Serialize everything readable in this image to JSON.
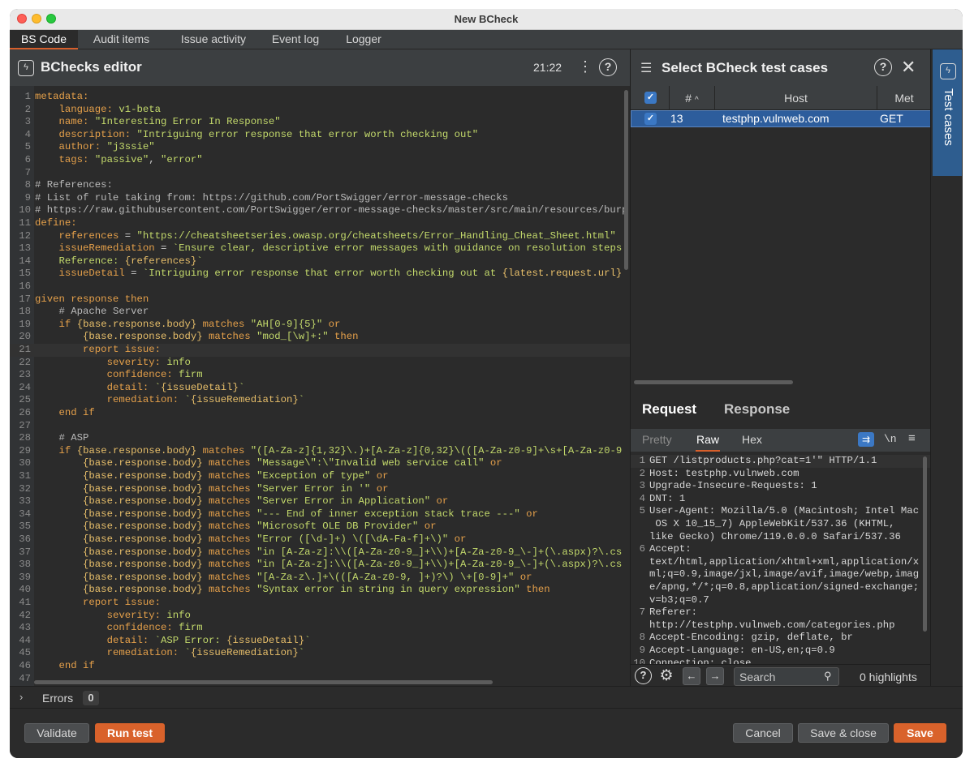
{
  "window": {
    "title": "New BCheck"
  },
  "tabs": [
    "BS Code",
    "Audit items",
    "Issue activity",
    "Event log",
    "Logger"
  ],
  "editor": {
    "title": "BChecks editor",
    "cursor_position": "21:22",
    "code_lines": [
      [
        [
          "k",
          "metadata:"
        ]
      ],
      [
        [
          "t",
          "    "
        ],
        [
          "k",
          "language:"
        ],
        [
          "t",
          " "
        ],
        [
          "s",
          "v1-beta"
        ]
      ],
      [
        [
          "t",
          "    "
        ],
        [
          "k",
          "name:"
        ],
        [
          "t",
          " "
        ],
        [
          "s",
          "\"Interesting Error In Response\""
        ]
      ],
      [
        [
          "t",
          "    "
        ],
        [
          "k",
          "description:"
        ],
        [
          "t",
          " "
        ],
        [
          "s",
          "\"Intriguing error response that error worth checking out\""
        ]
      ],
      [
        [
          "t",
          "    "
        ],
        [
          "k",
          "author:"
        ],
        [
          "t",
          " "
        ],
        [
          "s",
          "\"j3ssie\""
        ]
      ],
      [
        [
          "t",
          "    "
        ],
        [
          "k",
          "tags:"
        ],
        [
          "t",
          " "
        ],
        [
          "s",
          "\"passive\""
        ],
        [
          "t",
          ", "
        ],
        [
          "s",
          "\"error\""
        ]
      ],
      [],
      [
        [
          "c",
          "# References:"
        ]
      ],
      [
        [
          "c",
          "# List of rule taking from: https://github.com/PortSwigger/error-message-checks"
        ]
      ],
      [
        [
          "c",
          "# https://raw.githubusercontent.com/PortSwigger/error-message-checks/master/src/main/resources/burp"
        ]
      ],
      [
        [
          "k",
          "define:"
        ]
      ],
      [
        [
          "t",
          "    "
        ],
        [
          "k",
          "references"
        ],
        [
          "t",
          " = "
        ],
        [
          "s",
          "\"https://cheatsheetseries.owasp.org/cheatsheets/Error_Handling_Cheat_Sheet.html\""
        ]
      ],
      [
        [
          "t",
          "    "
        ],
        [
          "k",
          "issueRemediation"
        ],
        [
          "t",
          " = "
        ],
        [
          "s",
          "`Ensure clear, descriptive error messages with guidance on resolution steps"
        ]
      ],
      [
        [
          "t",
          "    "
        ],
        [
          "s",
          "Reference: "
        ],
        [
          "v",
          "{references}"
        ],
        [
          "s",
          "`"
        ]
      ],
      [
        [
          "t",
          "    "
        ],
        [
          "k",
          "issueDetail"
        ],
        [
          "t",
          " = "
        ],
        [
          "s",
          "`Intriguing error response that error worth checking out at "
        ],
        [
          "v",
          "{latest.request.url}"
        ]
      ],
      [],
      [
        [
          "k",
          "given response then"
        ]
      ],
      [
        [
          "t",
          "    "
        ],
        [
          "c",
          "# Apache Server"
        ]
      ],
      [
        [
          "t",
          "    "
        ],
        [
          "k",
          "if"
        ],
        [
          "t",
          " "
        ],
        [
          "v",
          "{base.response.body}"
        ],
        [
          "t",
          " "
        ],
        [
          "k",
          "matches"
        ],
        [
          "t",
          " "
        ],
        [
          "s",
          "\"AH[0-9]{5}\""
        ],
        [
          "t",
          " "
        ],
        [
          "k",
          "or"
        ]
      ],
      [
        [
          "t",
          "        "
        ],
        [
          "v",
          "{base.response.body}"
        ],
        [
          "t",
          " "
        ],
        [
          "k",
          "matches"
        ],
        [
          "t",
          " "
        ],
        [
          "s",
          "\"mod_[\\w]+:\""
        ],
        [
          "t",
          " "
        ],
        [
          "k",
          "then"
        ]
      ],
      [
        [
          "t",
          "        "
        ],
        [
          "k",
          "report issue:"
        ]
      ],
      [
        [
          "t",
          "            "
        ],
        [
          "k",
          "severity:"
        ],
        [
          "t",
          " "
        ],
        [
          "s",
          "info"
        ]
      ],
      [
        [
          "t",
          "            "
        ],
        [
          "k",
          "confidence:"
        ],
        [
          "t",
          " "
        ],
        [
          "s",
          "firm"
        ]
      ],
      [
        [
          "t",
          "            "
        ],
        [
          "k",
          "detail:"
        ],
        [
          "t",
          " "
        ],
        [
          "s",
          "`"
        ],
        [
          "v",
          "{issueDetail}"
        ],
        [
          "s",
          "`"
        ]
      ],
      [
        [
          "t",
          "            "
        ],
        [
          "k",
          "remediation:"
        ],
        [
          "t",
          " "
        ],
        [
          "s",
          "`"
        ],
        [
          "v",
          "{issueRemediation}"
        ],
        [
          "s",
          "`"
        ]
      ],
      [
        [
          "t",
          "    "
        ],
        [
          "k",
          "end if"
        ]
      ],
      [],
      [
        [
          "t",
          "    "
        ],
        [
          "c",
          "# ASP"
        ]
      ],
      [
        [
          "t",
          "    "
        ],
        [
          "k",
          "if"
        ],
        [
          "t",
          " "
        ],
        [
          "v",
          "{base.response.body}"
        ],
        [
          "t",
          " "
        ],
        [
          "k",
          "matches"
        ],
        [
          "t",
          " "
        ],
        [
          "s",
          "\"([A-Za-z]{1,32}\\.)+[A-Za-z]{0,32}\\(([A-Za-z0-9]+\\s+[A-Za-z0-9"
        ]
      ],
      [
        [
          "t",
          "        "
        ],
        [
          "v",
          "{base.response.body}"
        ],
        [
          "t",
          " "
        ],
        [
          "k",
          "matches"
        ],
        [
          "t",
          " "
        ],
        [
          "s",
          "\"Message\\\":\\\"Invalid web service call\""
        ],
        [
          "t",
          " "
        ],
        [
          "k",
          "or"
        ]
      ],
      [
        [
          "t",
          "        "
        ],
        [
          "v",
          "{base.response.body}"
        ],
        [
          "t",
          " "
        ],
        [
          "k",
          "matches"
        ],
        [
          "t",
          " "
        ],
        [
          "s",
          "\"Exception of type\""
        ],
        [
          "t",
          " "
        ],
        [
          "k",
          "or"
        ]
      ],
      [
        [
          "t",
          "        "
        ],
        [
          "v",
          "{base.response.body}"
        ],
        [
          "t",
          " "
        ],
        [
          "k",
          "matches"
        ],
        [
          "t",
          " "
        ],
        [
          "s",
          "\"Server Error in '\""
        ],
        [
          "t",
          " "
        ],
        [
          "k",
          "or"
        ]
      ],
      [
        [
          "t",
          "        "
        ],
        [
          "v",
          "{base.response.body}"
        ],
        [
          "t",
          " "
        ],
        [
          "k",
          "matches"
        ],
        [
          "t",
          " "
        ],
        [
          "s",
          "\"Server Error in Application\""
        ],
        [
          "t",
          " "
        ],
        [
          "k",
          "or"
        ]
      ],
      [
        [
          "t",
          "        "
        ],
        [
          "v",
          "{base.response.body}"
        ],
        [
          "t",
          " "
        ],
        [
          "k",
          "matches"
        ],
        [
          "t",
          " "
        ],
        [
          "s",
          "\"--- End of inner exception stack trace ---\""
        ],
        [
          "t",
          " "
        ],
        [
          "k",
          "or"
        ]
      ],
      [
        [
          "t",
          "        "
        ],
        [
          "v",
          "{base.response.body}"
        ],
        [
          "t",
          " "
        ],
        [
          "k",
          "matches"
        ],
        [
          "t",
          " "
        ],
        [
          "s",
          "\"Microsoft OLE DB Provider\""
        ],
        [
          "t",
          " "
        ],
        [
          "k",
          "or"
        ]
      ],
      [
        [
          "t",
          "        "
        ],
        [
          "v",
          "{base.response.body}"
        ],
        [
          "t",
          " "
        ],
        [
          "k",
          "matches"
        ],
        [
          "t",
          " "
        ],
        [
          "s",
          "\"Error ([\\d-]+) \\([\\dA-Fa-f]+\\)\""
        ],
        [
          "t",
          " "
        ],
        [
          "k",
          "or"
        ]
      ],
      [
        [
          "t",
          "        "
        ],
        [
          "v",
          "{base.response.body}"
        ],
        [
          "t",
          " "
        ],
        [
          "k",
          "matches"
        ],
        [
          "t",
          " "
        ],
        [
          "s",
          "\"in [A-Za-z]:\\\\([A-Za-z0-9_]+\\\\)+[A-Za-z0-9_\\-]+(\\.aspx)?\\.cs"
        ]
      ],
      [
        [
          "t",
          "        "
        ],
        [
          "v",
          "{base.response.body}"
        ],
        [
          "t",
          " "
        ],
        [
          "k",
          "matches"
        ],
        [
          "t",
          " "
        ],
        [
          "s",
          "\"in [A-Za-z]:\\\\([A-Za-z0-9_]+\\\\)+[A-Za-z0-9_\\-]+(\\.aspx)?\\.cs"
        ]
      ],
      [
        [
          "t",
          "        "
        ],
        [
          "v",
          "{base.response.body}"
        ],
        [
          "t",
          " "
        ],
        [
          "k",
          "matches"
        ],
        [
          "t",
          " "
        ],
        [
          "s",
          "\"[A-Za-z\\.]+\\(([A-Za-z0-9, ]+)?\\) \\+[0-9]+\""
        ],
        [
          "t",
          " "
        ],
        [
          "k",
          "or"
        ]
      ],
      [
        [
          "t",
          "        "
        ],
        [
          "v",
          "{base.response.body}"
        ],
        [
          "t",
          " "
        ],
        [
          "k",
          "matches"
        ],
        [
          "t",
          " "
        ],
        [
          "s",
          "\"Syntax error in string in query expression\""
        ],
        [
          "t",
          " "
        ],
        [
          "k",
          "then"
        ]
      ],
      [
        [
          "t",
          "        "
        ],
        [
          "k",
          "report issue:"
        ]
      ],
      [
        [
          "t",
          "            "
        ],
        [
          "k",
          "severity:"
        ],
        [
          "t",
          " "
        ],
        [
          "s",
          "info"
        ]
      ],
      [
        [
          "t",
          "            "
        ],
        [
          "k",
          "confidence:"
        ],
        [
          "t",
          " "
        ],
        [
          "s",
          "firm"
        ]
      ],
      [
        [
          "t",
          "            "
        ],
        [
          "k",
          "detail:"
        ],
        [
          "t",
          " "
        ],
        [
          "s",
          "`ASP Error: "
        ],
        [
          "v",
          "{issueDetail}"
        ],
        [
          "s",
          "`"
        ]
      ],
      [
        [
          "t",
          "            "
        ],
        [
          "k",
          "remediation:"
        ],
        [
          "t",
          " "
        ],
        [
          "s",
          "`"
        ],
        [
          "v",
          "{issueRemediation}"
        ],
        [
          "s",
          "`"
        ]
      ],
      [
        [
          "t",
          "    "
        ],
        [
          "k",
          "end if"
        ]
      ],
      []
    ],
    "current_line": 21
  },
  "test_cases": {
    "title": "Select BCheck test cases",
    "columns": [
      "#",
      "Host",
      "Met"
    ],
    "rows": [
      {
        "checked": true,
        "num": "13",
        "host": "testphp.vulnweb.com",
        "method": "GET"
      }
    ],
    "side_tab_label": "Test cases"
  },
  "message": {
    "tabs": [
      "Request",
      "Response"
    ],
    "active_tab": "Request",
    "formats": [
      "Pretty",
      "Raw",
      "Hex"
    ],
    "active_format": "Raw",
    "newline_label": "\\n",
    "lines": [
      {
        "n": "1",
        "text": "GET /listproducts.php?cat=1'\" HTTP/1.1"
      },
      {
        "n": "2",
        "text": "Host: testphp.vulnweb.com"
      },
      {
        "n": "3",
        "text": "Upgrade-Insecure-Requests: 1"
      },
      {
        "n": "4",
        "text": "DNT: 1"
      },
      {
        "n": "5",
        "text": "User-Agent: Mozilla/5.0 (Macintosh; Intel Mac"
      },
      {
        "n": "",
        "text": " OS X 10_15_7) AppleWebKit/537.36 (KHTML,"
      },
      {
        "n": "",
        "text": "like Gecko) Chrome/119.0.0.0 Safari/537.36"
      },
      {
        "n": "6",
        "text": "Accept:"
      },
      {
        "n": "",
        "text": "text/html,application/xhtml+xml,application/x"
      },
      {
        "n": "",
        "text": "ml;q=0.9,image/jxl,image/avif,image/webp,imag"
      },
      {
        "n": "",
        "text": "e/apng,*/*;q=0.8,application/signed-exchange;"
      },
      {
        "n": "",
        "text": "v=b3;q=0.7"
      },
      {
        "n": "7",
        "text": "Referer:"
      },
      {
        "n": "",
        "text": "http://testphp.vulnweb.com/categories.php"
      },
      {
        "n": "8",
        "text": "Accept-Encoding: gzip, deflate, br"
      },
      {
        "n": "9",
        "text": "Accept-Language: en-US,en;q=0.9"
      },
      {
        "n": "10",
        "text": "Connection: close"
      }
    ],
    "search_placeholder": "Search",
    "highlights": "0 highlights"
  },
  "errors": {
    "label": "Errors",
    "count": "0"
  },
  "buttons": {
    "validate": "Validate",
    "run_test": "Run test",
    "cancel": "Cancel",
    "save_close": "Save & close",
    "save": "Save"
  }
}
